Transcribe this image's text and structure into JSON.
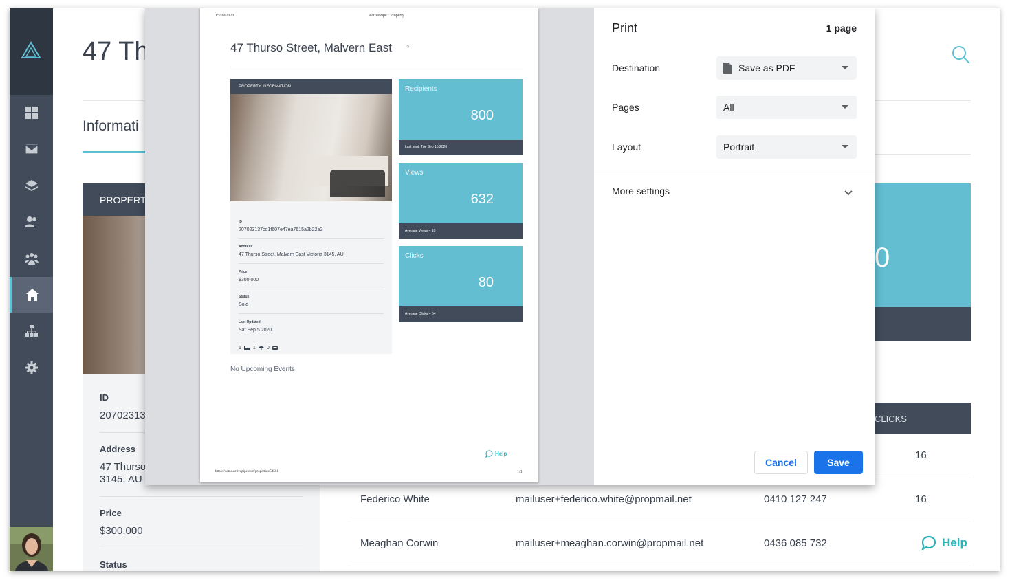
{
  "background": {
    "title": "47 Th",
    "tab_label": "Informati",
    "property_header": "PROPERTY",
    "fields": [
      {
        "label": "ID",
        "value": "20702313"
      },
      {
        "label": "Address",
        "value": "47 Thurso\n3145, AU"
      },
      {
        "label": "Price",
        "value": "$300,000"
      },
      {
        "label": "Status",
        "value": ""
      }
    ],
    "stat_value_partial": "0",
    "clicks_header": "CLICKS",
    "rows": [
      {
        "name": "",
        "email": "",
        "phone": "",
        "clicks": "16"
      },
      {
        "name": "Federico White",
        "email": "mailuser+federico.white@propmail.net",
        "phone": "0410 127 247",
        "clicks": "16"
      },
      {
        "name": "Meaghan Corwin",
        "email": "mailuser+meaghan.corwin@propmail.net",
        "phone": "0436 085 732",
        "clicks": ""
      }
    ],
    "help_label": "Help"
  },
  "preview": {
    "header_date": "15/09/2020",
    "header_title": "ActivePipe : Property",
    "title": "47 Thurso Street, Malvern East",
    "title_hint": "?",
    "panel_header": "PROPERTY INFORMATION",
    "fields": [
      {
        "label": "ID",
        "value": "207023137cd1f607e47ea7615a2b22a2"
      },
      {
        "label": "Address",
        "value": "47 Thurso Street, Malvern East Victoria 3145, AU"
      },
      {
        "label": "Price",
        "value": "$300,000"
      },
      {
        "label": "Status",
        "value": "Sold"
      },
      {
        "label": "Last Updated",
        "value": "Sat Sep 5 2020"
      }
    ],
    "features": {
      "beds": "1",
      "baths": "1",
      "cars": "0"
    },
    "stats": [
      {
        "label": "Recipients",
        "value": "800",
        "footer": "Last sent: Tue Sep 15 2020"
      },
      {
        "label": "Views",
        "value": "632",
        "footer": "Average Views = 10"
      },
      {
        "label": "Clicks",
        "value": "80",
        "footer": "Average Clicks = 54"
      }
    ],
    "events": "No Upcoming Events",
    "help_label": "Help",
    "footer_url": "https://demo.activepipe.com/properties/54561",
    "footer_page": "1/1"
  },
  "print": {
    "title": "Print",
    "page_count": "1 page",
    "destination_label": "Destination",
    "destination_value": "Save as PDF",
    "pages_label": "Pages",
    "pages_value": "All",
    "layout_label": "Layout",
    "layout_value": "Portrait",
    "more_settings": "More settings",
    "cancel": "Cancel",
    "save": "Save"
  },
  "colors": {
    "sidebar": "#414b5a",
    "accent": "#5ec1d3",
    "stat_tile": "#63bed2",
    "primary_button": "#1a73e8"
  }
}
